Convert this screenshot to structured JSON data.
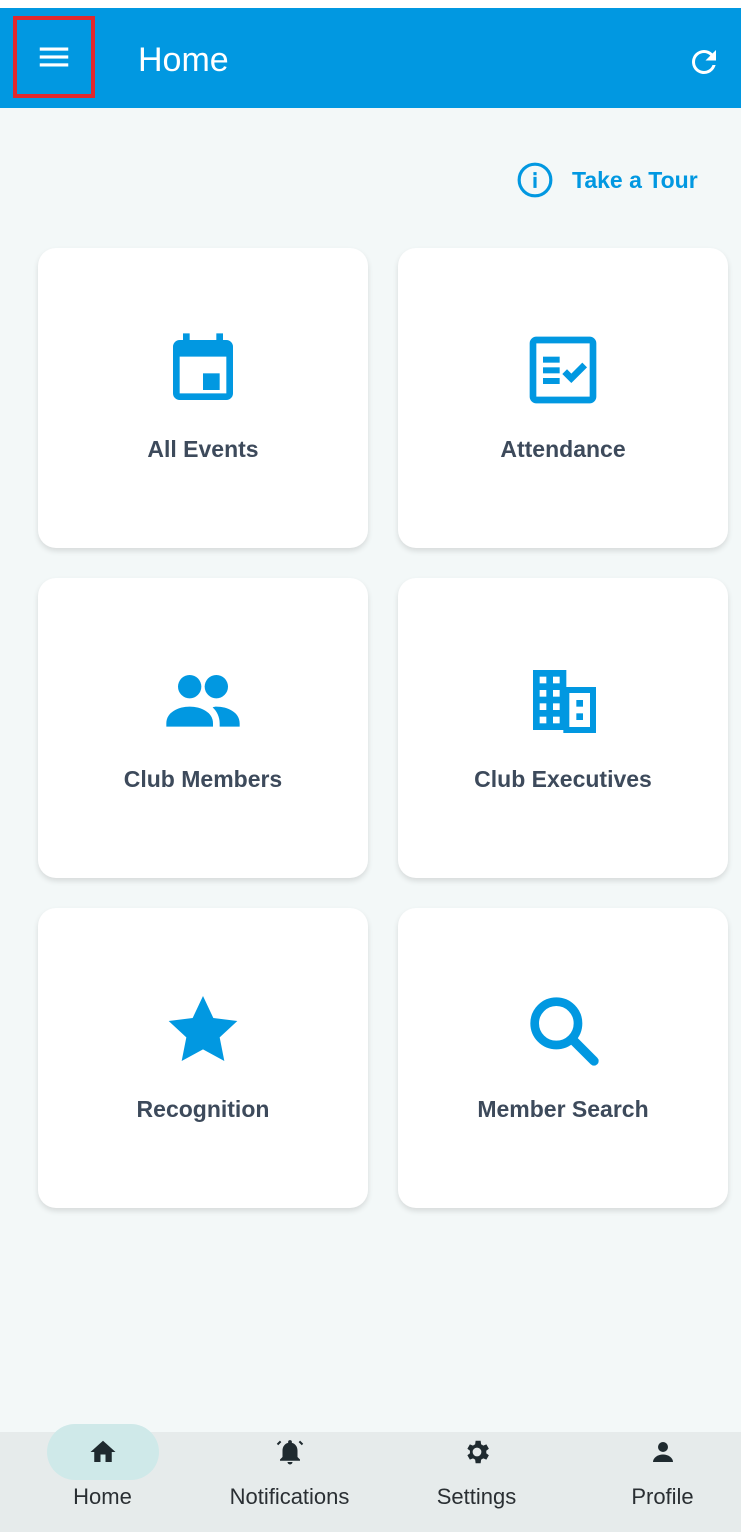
{
  "header": {
    "title": "Home",
    "menu_icon": "hamburger-menu-icon",
    "refresh_icon": "refresh-icon",
    "background": "#0198e1"
  },
  "tour": {
    "label": "Take a Tour",
    "icon": "info-icon"
  },
  "cards": [
    {
      "label": "All Events",
      "icon": "calendar-icon"
    },
    {
      "label": "Attendance",
      "icon": "checklist-icon"
    },
    {
      "label": "Club Members",
      "icon": "people-icon"
    },
    {
      "label": "Club Executives",
      "icon": "building-icon"
    },
    {
      "label": "Recognition",
      "icon": "star-icon"
    },
    {
      "label": "Member Search",
      "icon": "search-icon"
    }
  ],
  "bottom_nav": {
    "items": [
      {
        "label": "Home",
        "icon": "home-icon",
        "active": true
      },
      {
        "label": "Notifications",
        "icon": "bell-icon",
        "active": false
      },
      {
        "label": "Settings",
        "icon": "gear-icon",
        "active": false
      },
      {
        "label": "Profile",
        "icon": "person-icon",
        "active": false
      }
    ]
  },
  "colors": {
    "accent": "#0198e1",
    "page_background": "#f3f8f8",
    "card_text": "#3d4a5b",
    "highlight_box": "#e0282d",
    "active_pill": "#cfe9e9"
  }
}
